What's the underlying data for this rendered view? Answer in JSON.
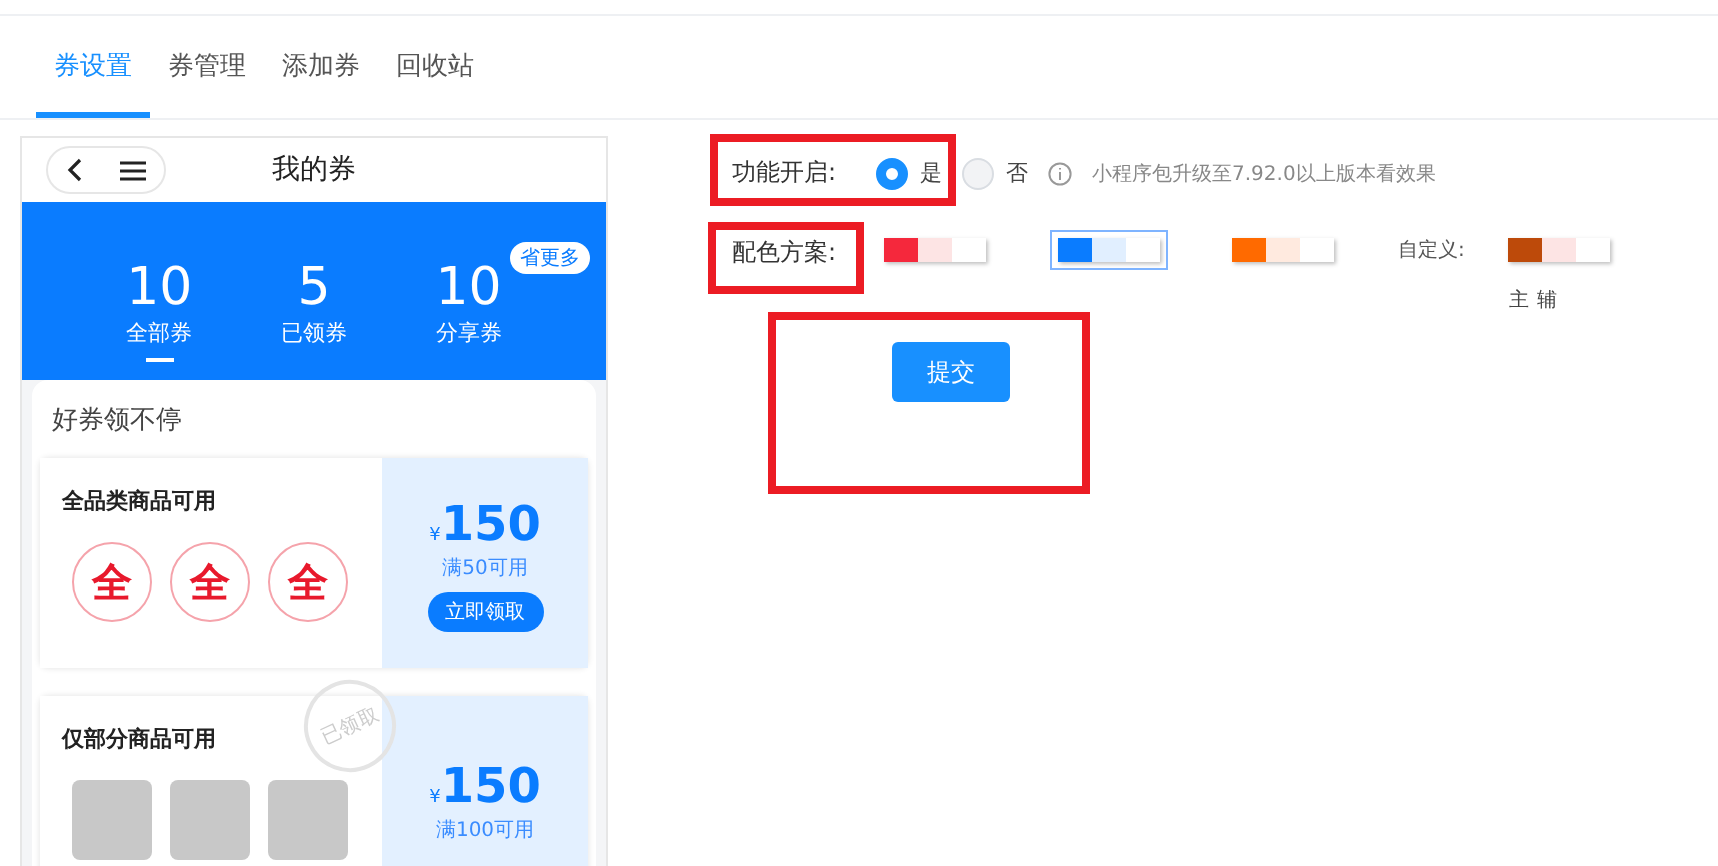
{
  "tabs": [
    {
      "label": "券设置",
      "selected": true
    },
    {
      "label": "券管理",
      "selected": false
    },
    {
      "label": "添加券",
      "selected": false
    },
    {
      "label": "回收站",
      "selected": false
    }
  ],
  "phone": {
    "title": "我的券",
    "badge": "省更多",
    "stats": [
      {
        "value": "10",
        "label": "全部券",
        "selected": true
      },
      {
        "value": "5",
        "label": "已领券",
        "selected": false
      },
      {
        "value": "10",
        "label": "分享券",
        "selected": false
      }
    ],
    "section_title": "好券领不停",
    "coupons": [
      {
        "kind": "badges",
        "title": "全品类商品可用",
        "badges": [
          "全",
          "全",
          "全"
        ],
        "currency": "¥",
        "amount": "150",
        "condition": "满50可用",
        "button": "立即领取",
        "claimed": false
      },
      {
        "kind": "photos",
        "title": "仅部分商品可用",
        "currency": "¥",
        "amount": "150",
        "condition": "满100可用",
        "claimed": true,
        "stamp": "已领取"
      }
    ]
  },
  "settings": {
    "feature_label": "功能开启:",
    "feature_options": [
      {
        "label": "是",
        "selected": true
      },
      {
        "label": "否",
        "selected": false
      }
    ],
    "hint": "小程序包升级至7.92.0以上版本看效果",
    "scheme_label": "配色方案:",
    "schemes": [
      {
        "swatches": [
          {
            "color": "#f5283c"
          },
          {
            "color": "#fde4e4"
          }
        ],
        "selected": false
      },
      {
        "swatches": [
          {
            "color": "#0a7cff"
          },
          {
            "color": "#e1efff"
          }
        ],
        "selected": true
      },
      {
        "swatches": [
          {
            "color": "#ff6a00"
          },
          {
            "color": "#ffeadf"
          }
        ],
        "selected": false
      }
    ],
    "custom_label": "自定义:",
    "custom": {
      "swatches": [
        {
          "color": "#bd4a0a"
        },
        {
          "color": "#fde4e4"
        }
      ]
    },
    "legend": [
      "主",
      "辅"
    ],
    "submit": "提交"
  }
}
